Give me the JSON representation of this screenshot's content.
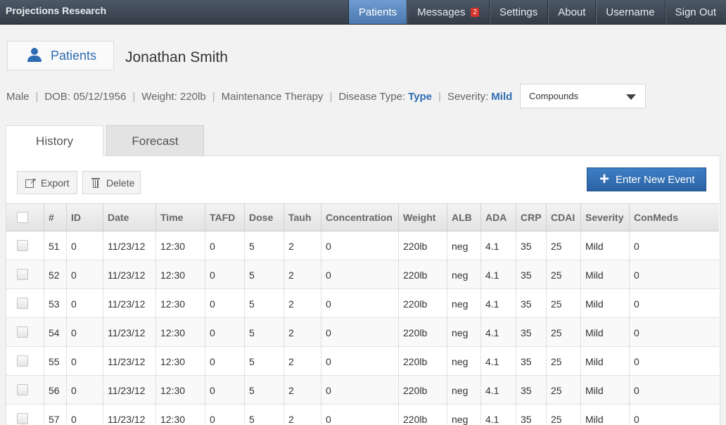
{
  "app": {
    "brand": "Projections Research"
  },
  "nav": [
    {
      "label": "Patients",
      "active": true
    },
    {
      "label": "Messages",
      "badge": "2"
    },
    {
      "label": "Settings"
    },
    {
      "label": "About"
    },
    {
      "label": "Username"
    },
    {
      "label": "Sign Out"
    }
  ],
  "header": {
    "back_label": "Patients",
    "patient_name": "Jonathan Smith"
  },
  "patient_info": {
    "gender": "Male",
    "dob": "DOB: 05/12/1956",
    "weight": "Weight: 220lb",
    "therapy": "Maintenance Therapy",
    "disease_label": "Disease Type:",
    "disease_value": "Type",
    "severity_label": "Severity:",
    "severity_value": "Mild"
  },
  "compounds_select": {
    "value": "Compounds"
  },
  "tabs": [
    {
      "label": "History",
      "active": true
    },
    {
      "label": "Forecast"
    }
  ],
  "toolbar": {
    "export_label": "Export",
    "delete_label": "Delete",
    "new_event_label": "Enter New Event"
  },
  "table": {
    "columns": [
      "#",
      "ID",
      "Date",
      "Time",
      "TAFD",
      "Dose",
      "Tauh",
      "Concentration",
      "Weight",
      "ALB",
      "ADA",
      "CRP",
      "CDAI",
      "Severity",
      "ConMeds"
    ],
    "rows": [
      [
        "51",
        "0",
        "11/23/12",
        "12:30",
        "0",
        "5",
        "2",
        "0",
        "220lb",
        "neg",
        "4.1",
        "35",
        "25",
        "Mild",
        "0"
      ],
      [
        "52",
        "0",
        "11/23/12",
        "12:30",
        "0",
        "5",
        "2",
        "0",
        "220lb",
        "neg",
        "4.1",
        "35",
        "25",
        "Mild",
        "0"
      ],
      [
        "53",
        "0",
        "11/23/12",
        "12:30",
        "0",
        "5",
        "2",
        "0",
        "220lb",
        "neg",
        "4.1",
        "35",
        "25",
        "Mild",
        "0"
      ],
      [
        "54",
        "0",
        "11/23/12",
        "12:30",
        "0",
        "5",
        "2",
        "0",
        "220lb",
        "neg",
        "4.1",
        "35",
        "25",
        "Mild",
        "0"
      ],
      [
        "55",
        "0",
        "11/23/12",
        "12:30",
        "0",
        "5",
        "2",
        "0",
        "220lb",
        "neg",
        "4.1",
        "35",
        "25",
        "Mild",
        "0"
      ],
      [
        "56",
        "0",
        "11/23/12",
        "12:30",
        "0",
        "5",
        "2",
        "0",
        "220lb",
        "neg",
        "4.1",
        "35",
        "25",
        "Mild",
        "0"
      ],
      [
        "57",
        "0",
        "11/23/12",
        "12:30",
        "0",
        "5",
        "2",
        "0",
        "220lb",
        "neg",
        "4.1",
        "35",
        "25",
        "Mild",
        "0"
      ]
    ]
  }
}
